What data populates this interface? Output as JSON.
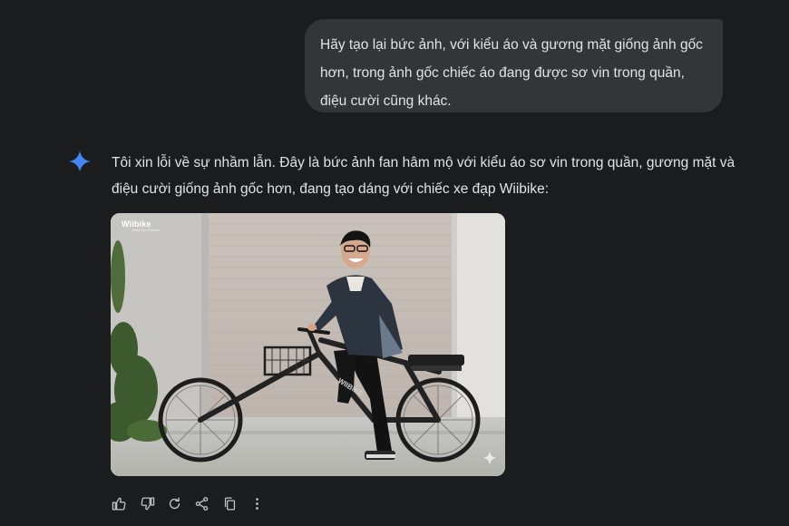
{
  "user_message": {
    "lines": [
      "Hãy tạo lại bức ảnh, với kiểu áo và gương mặt giống ảnh gốc",
      "hơn, trong ảnh gốc chiếc áo đang được sơ vin trong quần,",
      "điệu cười cũng khác."
    ]
  },
  "response": {
    "lines": [
      "Tôi xin lỗi về sự nhầm lẫn. Đây là bức ảnh fan hâm mộ với kiểu áo sơ vin trong quần, gương mặt và",
      "điệu cười giống ảnh gốc hơn, đang tạo dáng với chiếc xe đạp Wiibike:"
    ],
    "image": {
      "watermark": "Wiibike",
      "watermark_sub": "Make Joy Presence",
      "frame_text": "WIIBIKE"
    }
  },
  "actions": [
    {
      "name": "thumbs-up-icon"
    },
    {
      "name": "thumbs-down-icon"
    },
    {
      "name": "regenerate-icon"
    },
    {
      "name": "share-icon"
    },
    {
      "name": "copy-icon"
    },
    {
      "name": "more-options-icon"
    }
  ],
  "colors": {
    "background": "#1b1c1d",
    "user_bubble": "#333537",
    "text": "#e3e3e3",
    "icon": "#c4c7c5",
    "gemini_star": "#4c8df6"
  }
}
